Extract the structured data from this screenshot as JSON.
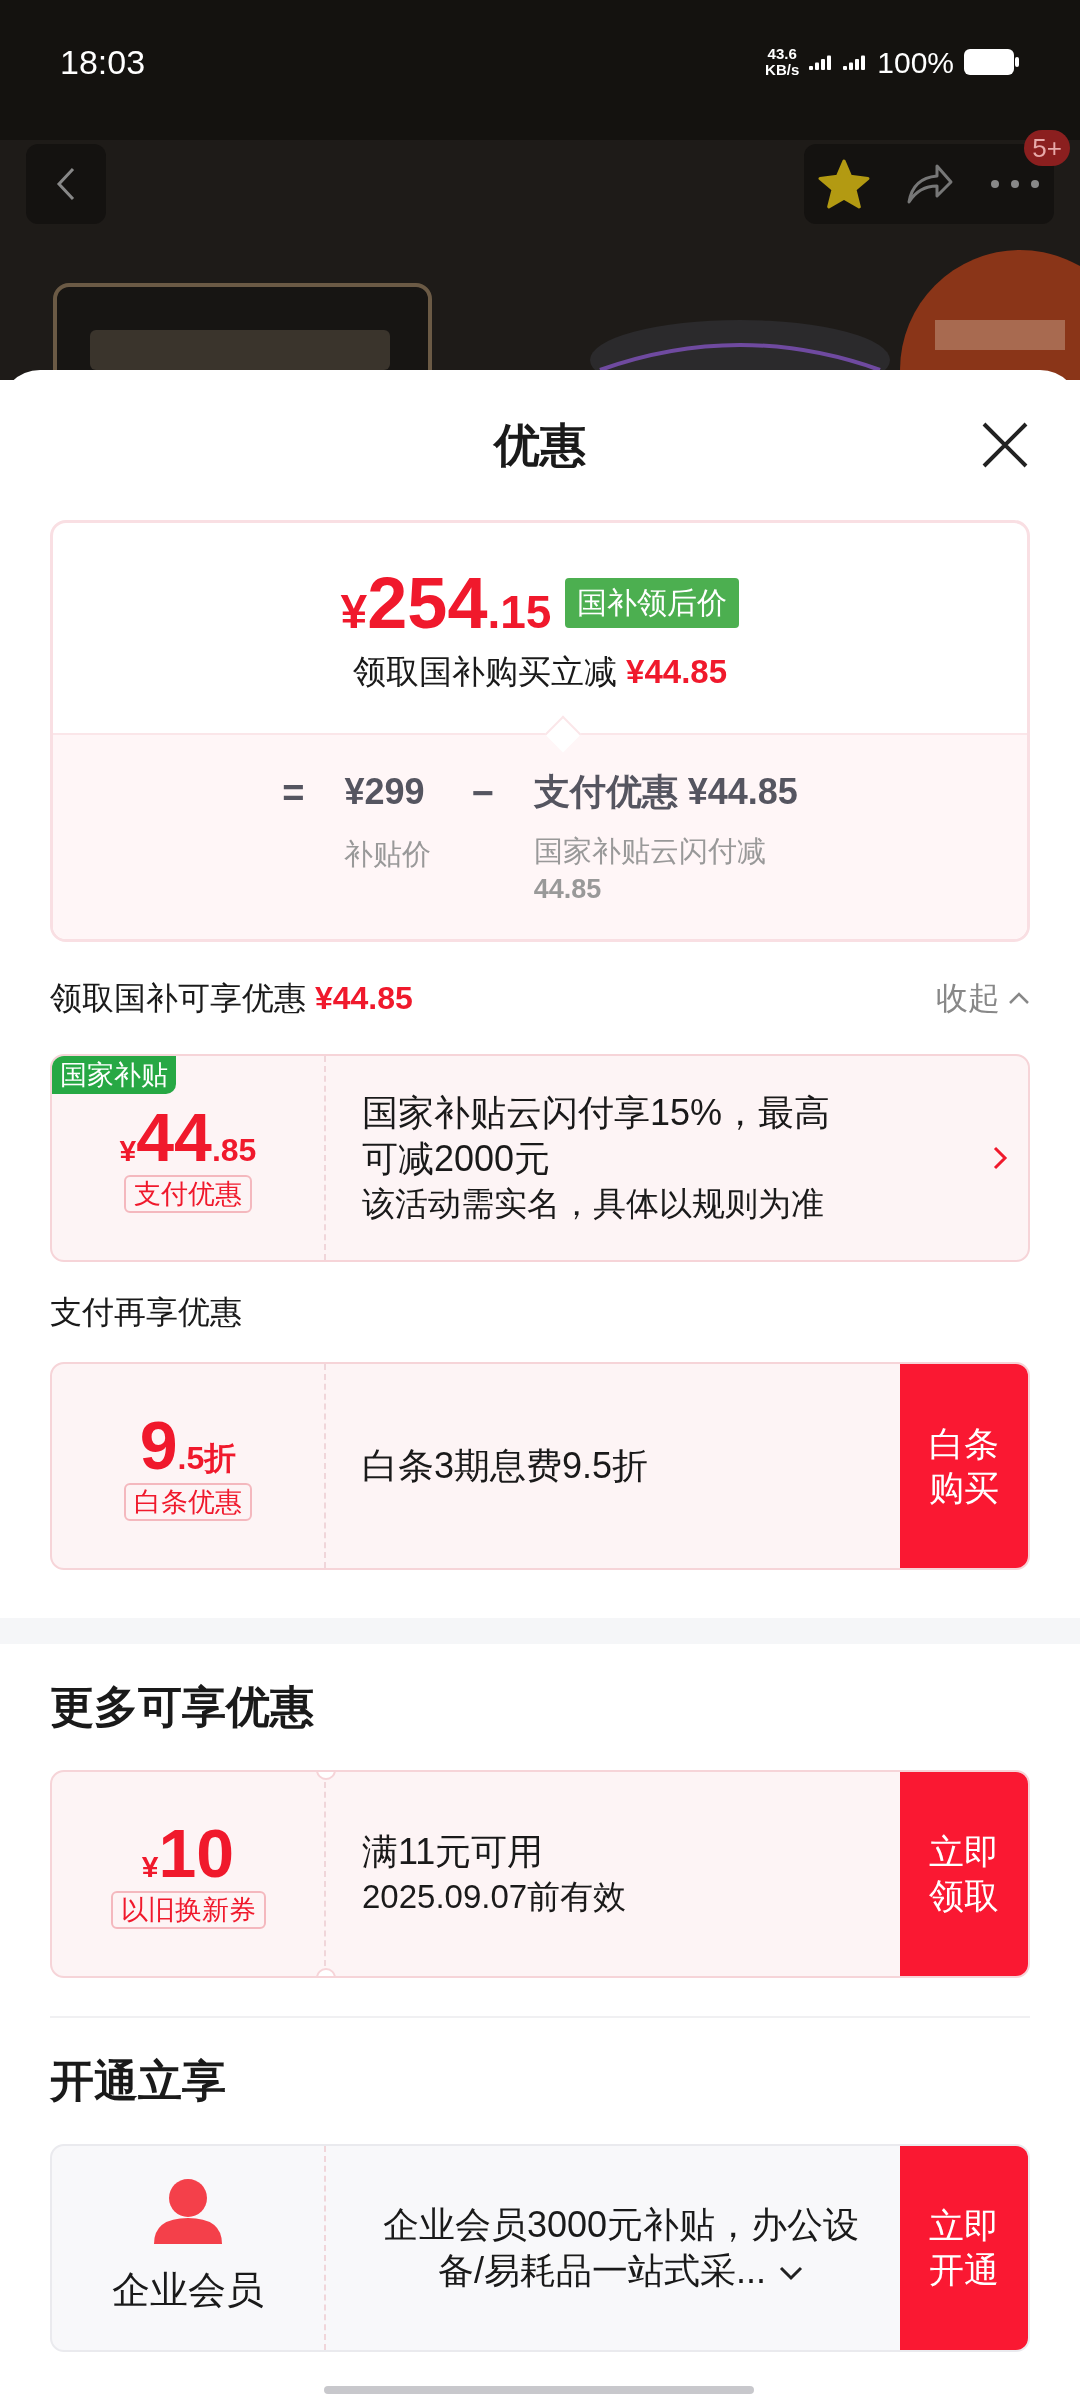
{
  "status_bar": {
    "time": "18:03",
    "speed": "43.6",
    "speed_unit": "KB/s",
    "battery": "100%"
  },
  "nav": {
    "badge": "5+",
    "favorited": true
  },
  "sheet": {
    "title": "优惠"
  },
  "summary": {
    "currency": "¥",
    "integer": "254",
    "decimal": ".15",
    "tag": "国补领后价",
    "subtitle": "领取国补购买立减",
    "subtitle_amount": "¥44.85",
    "equals": "=",
    "base_price": "¥299",
    "base_label": "补贴价",
    "minus": "−",
    "discount": "支付优惠 ¥44.85",
    "discount_note": "国家补贴云闪付减",
    "discount_note_amount": "44.85"
  },
  "section_row": {
    "label": "领取国补可享优惠",
    "amount": "¥44.85",
    "toggle": "收起",
    "expanded": true
  },
  "groups": [
    {
      "coupons": [
        {
          "kind": "subsidy",
          "tag": "国家补贴",
          "currency": "¥",
          "integer": "44",
          "decimal": ".85",
          "label": "支付优惠",
          "title": "国家补贴云闪付享15%，最高可减2000元",
          "note": "该活动需实名，具体以规则为准",
          "notched": false
        }
      ]
    },
    {
      "kind": "subsection",
      "heading": "支付再享优惠",
      "coupons": [
        {
          "kind": "offer",
          "integer": "9",
          "decimal": ".5折",
          "label": "白条优惠",
          "title": "白条3期息费9.5折",
          "button": "白条购买",
          "notched": false
        }
      ]
    },
    {
      "kind": "section",
      "heading": "更多可享优惠",
      "band": true,
      "coupons": [
        {
          "kind": "offer",
          "currency": "¥",
          "integer": "10",
          "label": "以旧换新券",
          "title": "满11元可用",
          "note": "2025.09.07前有效",
          "button": "立即领取",
          "notched": true
        }
      ]
    },
    {
      "kind": "section",
      "heading": "开通立享",
      "rule": true,
      "coupons": [
        {
          "kind": "member",
          "label": "企业会员",
          "title": "企业会员3000元补贴，办公设备/易耗品一站式采...",
          "expanded": false,
          "button": "立即开通",
          "notched": false
        }
      ]
    }
  ]
}
